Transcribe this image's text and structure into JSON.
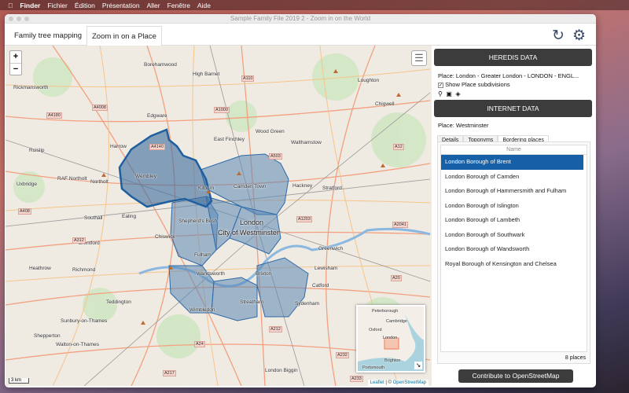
{
  "menubar": {
    "apple": "",
    "items": [
      "Finder",
      "Fichier",
      "Édition",
      "Présentation",
      "Aller",
      "Fenêtre",
      "Aide"
    ]
  },
  "window": {
    "title": "Sample Family File 2019 2 - Zoom in on the World"
  },
  "tabs": [
    {
      "label": "Family tree mapping"
    },
    {
      "label": "Zoom in on a Place"
    }
  ],
  "toolbar": {
    "refresh_icon": "refresh-icon",
    "settings_icon": "gear-icon"
  },
  "map": {
    "zoom_in": "+",
    "zoom_out": "−",
    "places": [
      "Borehamwood",
      "High Barnet",
      "Loughton",
      "Rickmansworth",
      "Chigwell",
      "Edgware",
      "East Finchley",
      "Wood Green",
      "Walthamstow",
      "Ruislip",
      "Harrow",
      "Wembley",
      "Kilburn",
      "Camden Town",
      "Hackney",
      "Stratford",
      "Uxbridge",
      "Northolt",
      "RAF Northolt",
      "Southall",
      "Ealing",
      "London",
      "City of Westminster",
      "Shepherd's Bush",
      "Chiswick",
      "Brentford",
      "Greenwich",
      "Richmond",
      "Fulham",
      "Wandsworth",
      "Brixton",
      "Lewisham",
      "Heathrow",
      "Catford",
      "Teddington",
      "Streatham",
      "Sydenham",
      "Wimbledon",
      "Sunbury-on-Thames",
      "Shepperton",
      "Walton-on-Thames",
      "London Biggin"
    ],
    "roads": [
      "A110",
      "A1000",
      "A4008",
      "A4180",
      "A503",
      "A12",
      "A4140",
      "A1203",
      "A2041",
      "A408",
      "A312",
      "A24",
      "A212",
      "A232",
      "A233",
      "A20",
      "A217"
    ],
    "scale": "3 km",
    "minimap": {
      "places": [
        "Peterborough",
        "Cambridge",
        "Oxford",
        "London",
        "Brighton",
        "Portsmouth"
      ]
    },
    "attribution": {
      "leaflet": "Leaflet",
      "sep": " | © ",
      "osm": "OpenStreetMap"
    },
    "polygon_color": "#1f5fa0"
  },
  "panel": {
    "heredis_header": "HEREDIS DATA",
    "place": "Place: London - Greater London - LONDON - ENGL...",
    "show_subdivisions": "Show Place subdivisions",
    "show_subdivisions_checked": true,
    "internet_header": "INTERNET DATA",
    "internet_place": "Place: Westminster",
    "subtabs": [
      "Details",
      "Toponyms",
      "Bordering places"
    ],
    "active_subtab": "Bordering places",
    "column": "Name",
    "items": [
      "London Borough of Brent",
      "London Borough of Camden",
      "London Borough of Hammersmith and Fulham",
      "London Borough of Islington",
      "London Borough of Lambeth",
      "London Borough of Southwark",
      "London Borough of Wandsworth",
      "Royal Borough of Kensington and Chelsea"
    ],
    "selected_index": 0,
    "count": "8 places",
    "contribute": "Contribute to OpenStreetMap",
    "selection_color": "#1660a8"
  }
}
